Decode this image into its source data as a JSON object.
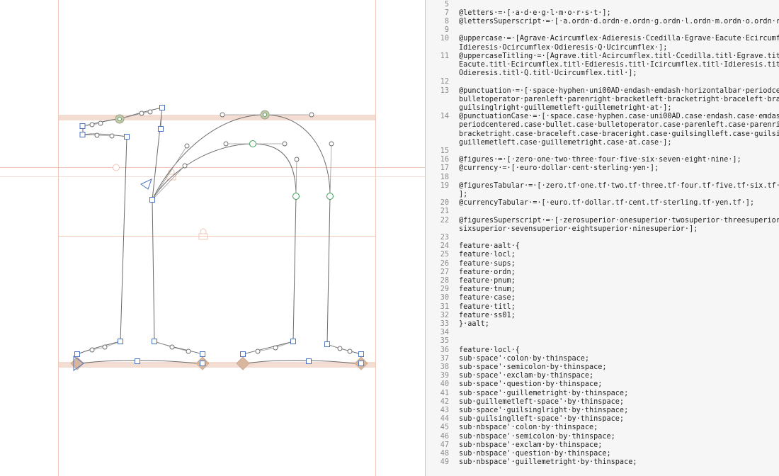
{
  "canvas": {
    "colors": {
      "guide": "#f1c9b9",
      "metrics_band": "#f3ddd2",
      "outline": "#6a6a6a",
      "handle_line": "#9a9a9a",
      "node_corner": "#4a73c4",
      "node_smooth": "#3a9a57",
      "anchor_diamond": "#d9b79f",
      "selected_node": "#b8b8a0"
    },
    "icons": [
      "lock-icon",
      "lock-icon",
      "start-point-arrow-icon"
    ]
  },
  "code": {
    "lines": [
      {
        "number": "5",
        "text": ""
      },
      {
        "number": "7",
        "text": "@letters·=·[·a·d·e·g·l·m·o·r·s·t·];"
      },
      {
        "number": "8",
        "text": "@lettersSuperscript·=·[·a.ordn·d.ordn·e.ordn·g.ordn·l.ordn·m.ordn·o.ordn·r.ordn·s.ordn"
      },
      {
        "number": "9",
        "text": ""
      },
      {
        "number": "10",
        "text": "@uppercase·=·[Agrave·Acircumflex·Adieresis·Ccedilla·Egrave·Eacute·Ecircumflex·Edieresis"
      },
      {
        "number": "",
        "text": "Idieresis·Ocircumflex·Odieresis·Q·Ucircumflex·];"
      },
      {
        "number": "11",
        "text": "@uppercaseTitling·=·[Agrave.titl·Acircumflex.titl·Ccedilla.titl·Egrave.titl"
      },
      {
        "number": "",
        "text": "Eacute.titl·Ecircumflex.titl·Edieresis.titl·Icircumflex.titl·Idieresis.titl·Ocircumflex.titl"
      },
      {
        "number": "",
        "text": "Odieresis.titl·Q.titl·Ucircumflex.titl·];"
      },
      {
        "number": "12",
        "text": ""
      },
      {
        "number": "13",
        "text": "@punctuation·=·[·space·hyphen·uni00AD·endash·emdash·horizontalbar·periodcentered·bullet"
      },
      {
        "number": "",
        "text": "bulletoperator·parenleft·parenright·bracketleft·bracketright·braceleft·braceright·guilsinglleft"
      },
      {
        "number": "",
        "text": "guilsinglright·guillemetleft·guillemetright·at·];"
      },
      {
        "number": "14",
        "text": "@punctuationCase·=·[·space.case·hyphen.case·uni00AD.case·endash.case·emdash.case"
      },
      {
        "number": "",
        "text": "periodcentered.case·bullet.case·bulletoperator.case·parenleft.case·parenright.case"
      },
      {
        "number": "",
        "text": "bracketright.case·braceleft.case·braceright.case·guilsinglleft.case·guilsinglright.case"
      },
      {
        "number": "",
        "text": "guillemetleft.case·guillemetright.case·at.case·];"
      },
      {
        "number": "15",
        "text": ""
      },
      {
        "number": "16",
        "text": "@figures·=·[·zero·one·two·three·four·five·six·seven·eight·nine·];"
      },
      {
        "number": "17",
        "text": "@currency·=·[·euro·dollar·cent·sterling·yen·];"
      },
      {
        "number": "18",
        "text": ""
      },
      {
        "number": "19",
        "text": "@figuresTabular·=·[·zero.tf·one.tf·two.tf·three.tf·four.tf·five.tf·six.tf·seven.tf"
      },
      {
        "number": "",
        "text": "];"
      },
      {
        "number": "20",
        "text": "@currencyTabular·=·[·euro.tf·dollar.tf·cent.tf·sterling.tf·yen.tf·];"
      },
      {
        "number": "21",
        "text": ""
      },
      {
        "number": "22",
        "text": "@figuresSuperscript·=·[·zerosuperior·onesuperior·twosuperior·threesuperior·foursuperior"
      },
      {
        "number": "",
        "text": "sixsuperior·sevensuperior·eightsuperior·ninesuperior·];"
      },
      {
        "number": "23",
        "text": ""
      },
      {
        "number": "24",
        "text": "feature·aalt·{"
      },
      {
        "number": "25",
        "text": "feature·locl;"
      },
      {
        "number": "26",
        "text": "feature·sups;"
      },
      {
        "number": "27",
        "text": "feature·ordn;"
      },
      {
        "number": "28",
        "text": "feature·pnum;"
      },
      {
        "number": "29",
        "text": "feature·tnum;"
      },
      {
        "number": "30",
        "text": "feature·case;"
      },
      {
        "number": "31",
        "text": "feature·titl;"
      },
      {
        "number": "32",
        "text": "feature·ss01;"
      },
      {
        "number": "33",
        "text": "}·aalt;"
      },
      {
        "number": "34",
        "text": ""
      },
      {
        "number": "35",
        "text": ""
      },
      {
        "number": "36",
        "text": "feature·locl·{"
      },
      {
        "number": "37",
        "text": "sub·space'·colon·by·thinspace;"
      },
      {
        "number": "38",
        "text": "sub·space'·semicolon·by·thinspace;"
      },
      {
        "number": "39",
        "text": "sub·space'·exclam·by·thinspace;"
      },
      {
        "number": "40",
        "text": "sub·space'·question·by·thinspace;"
      },
      {
        "number": "41",
        "text": "sub·space'·guillemetright·by·thinspace;"
      },
      {
        "number": "42",
        "text": "sub·guillemetleft·space'·by·thinspace;"
      },
      {
        "number": "43",
        "text": "sub·space'·guilsinglright·by·thinspace;"
      },
      {
        "number": "44",
        "text": "sub·guilsinglleft·space'·by·thinspace;"
      },
      {
        "number": "45",
        "text": "sub·nbspace'·colon·by·thinspace;"
      },
      {
        "number": "46",
        "text": "sub·nbspace'·semicolon·by·thinspace;"
      },
      {
        "number": "47",
        "text": "sub·nbspace'·exclam·by·thinspace;"
      },
      {
        "number": "48",
        "text": "sub·nbspace'·question·by·thinspace;"
      },
      {
        "number": "49",
        "text": "sub·nbspace'·guillemetright·by·thinspace;"
      }
    ]
  }
}
